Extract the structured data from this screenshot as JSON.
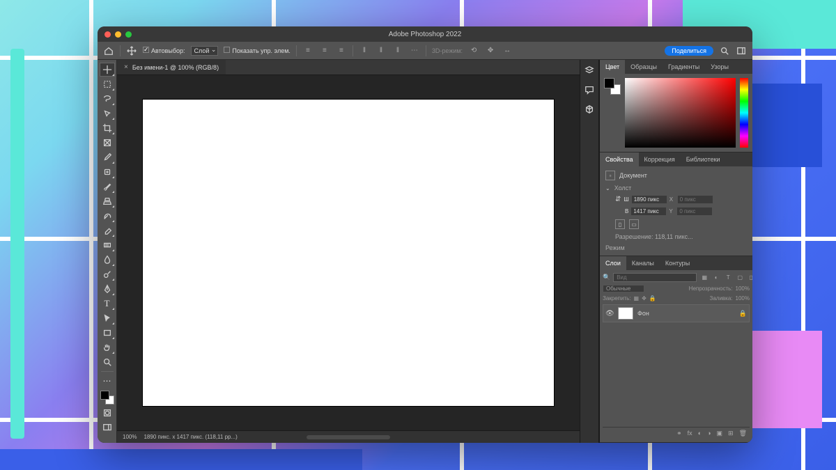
{
  "window": {
    "title": "Adobe Photoshop 2022"
  },
  "optionsbar": {
    "autoselect_on": true,
    "autoselect_label": "Автовыбор:",
    "autoselect_mode": "Слой",
    "show_transform_label": "Показать упр. элем.",
    "mode3d_label": "3D-режим:",
    "share_label": "Поделиться"
  },
  "document": {
    "tab_title": "Без имени-1 @ 100% (RGB/8)",
    "zoom": "100%",
    "status": "1890 пикс. x 1417 пикс. (118,11 pp...)"
  },
  "panels": {
    "color": {
      "tabs": [
        "Цвет",
        "Образцы",
        "Градиенты",
        "Узоры"
      ],
      "active": 0
    },
    "properties": {
      "tabs": [
        "Свойства",
        "Коррекция",
        "Библиотеки"
      ],
      "active": 0,
      "doc_label": "Документ",
      "canvas_label": "Холст",
      "width_label": "Ш",
      "width_value": "1890 пикс",
      "height_label": "В",
      "height_value": "1417 пикс",
      "x_label": "X",
      "x_value": "0 пикс",
      "y_label": "Y",
      "y_value": "0 пикс",
      "resolution_label": "Разрешение: 118,11 пикс...",
      "mode_label": "Режим"
    },
    "layers": {
      "tabs": [
        "Слои",
        "Каналы",
        "Контуры"
      ],
      "active": 0,
      "search_placeholder": "Вид",
      "blend_mode": "Обычные",
      "opacity_label": "Непрозрачность:",
      "opacity_value": "100%",
      "lock_label": "Закрепить:",
      "fill_label": "Заливка:",
      "fill_value": "100%",
      "rows": [
        {
          "name": "Фон",
          "locked": true
        }
      ]
    }
  },
  "tools": [
    "move",
    "artboard",
    "marquee",
    "lasso",
    "quick-select",
    "crop",
    "frame",
    "eyedropper",
    "spot-heal",
    "brush",
    "clone",
    "history-brush",
    "eraser",
    "gradient",
    "blur",
    "dodge",
    "pen",
    "type",
    "path-select",
    "rectangle",
    "hand",
    "zoom",
    "edit-toolbar"
  ]
}
